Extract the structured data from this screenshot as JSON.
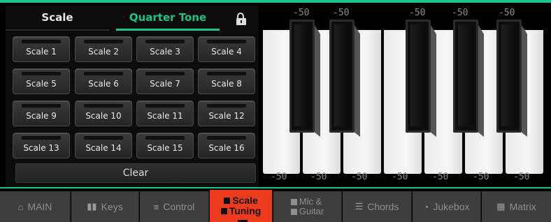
{
  "tabs": {
    "scale": "Scale",
    "quarter_tone": "Quarter Tone",
    "lock_state": "unlocked"
  },
  "scales": [
    "Scale 1",
    "Scale  2",
    "Scale 3",
    "Scale 4",
    "Scale 5",
    "Scale 6",
    "Scale 7",
    "Scale 8",
    "Scale 9",
    "Scale 10",
    "Scale 11",
    "Scale 12",
    "Scale 13",
    "Scale 14",
    "Scale 15",
    "Scale 16"
  ],
  "clear_label": "Clear",
  "keyboard": {
    "black_key_cents": [
      "-50",
      "-50",
      "-50",
      "-50",
      "-50"
    ],
    "white_key_cents": [
      "-50",
      "-50",
      "-50",
      "-50",
      "-50",
      "-50",
      "-50"
    ]
  },
  "nav": {
    "main": "MAIN",
    "keys": "Keys",
    "control": "Control",
    "scale_line1": "Scale",
    "scale_line2": "Tuning",
    "mic_line1": "Mic &",
    "mic_line2": "Guitar",
    "chords": "Chords",
    "jukebox": "Jukebox",
    "matrix": "Matrix"
  },
  "colors": {
    "accent": "#1cc28f",
    "active_tab": "#ee3b1e"
  }
}
